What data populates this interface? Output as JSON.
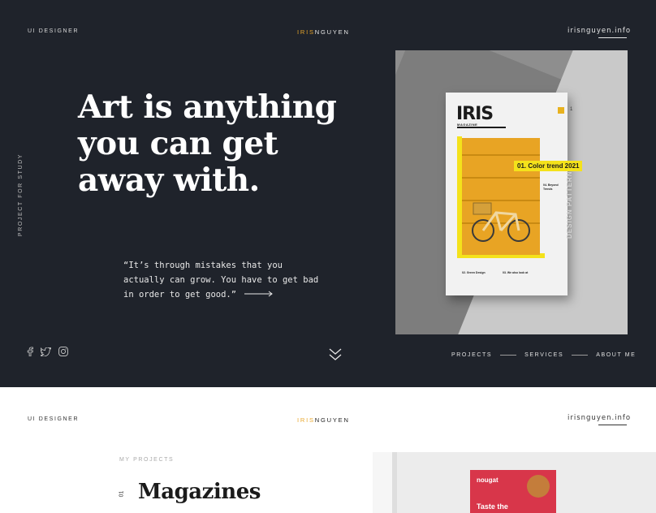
{
  "hero": {
    "role_label": "UI DESIGNER",
    "logo_part1": "IRIS",
    "logo_part2": "NGUYEN",
    "site_link": "irisnguyen.info",
    "side_label": "PROJECT FOR STUDY",
    "headline": "Art is anything you can get away with.",
    "quote": "“It’s through mistakes that you actually can grow. You have to get bad in order to get good.”",
    "socials": [
      "facebook-icon",
      "twitter-icon",
      "instagram-icon"
    ],
    "nav": [
      "PROJECTS",
      "SERVICES",
      "ABOUT ME"
    ],
    "colors": {
      "background": "#1f232b",
      "accent": "#e8a62a"
    }
  },
  "magazine": {
    "title": "IRIS",
    "subtitle": "MAGAZINE",
    "number": "1",
    "tag": "01. Color trend 2021",
    "col1_head": "02. Green Design",
    "col2_head": "03. We also look at",
    "col3_head": "04. Beyond Trends",
    "side_text": "DESIGN PATTERN",
    "colors": {
      "yellow": "#f4e21b",
      "orange": "#e8a424"
    }
  },
  "section2": {
    "role_label": "UI DESIGNER",
    "logo_part1": "IRIS",
    "logo_part2": "NGUYEN",
    "site_link": "irisnguyen.info",
    "kicker": "MY PROJECTS",
    "index": "01",
    "title": "Magazines",
    "poster_brand": "nougat",
    "poster_text": "Taste the"
  }
}
